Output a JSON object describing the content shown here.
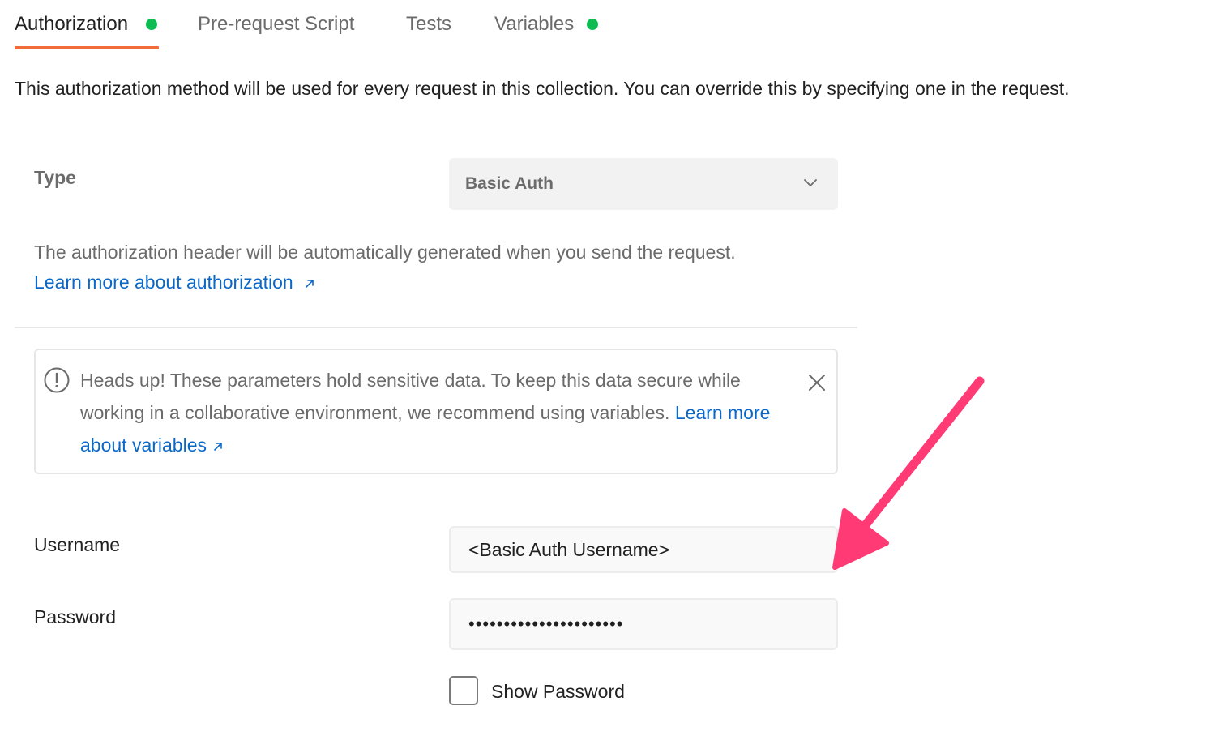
{
  "tabs": [
    {
      "label": "Authorization",
      "active": true,
      "has_indicator": true
    },
    {
      "label": "Pre-request Script",
      "active": false,
      "has_indicator": false
    },
    {
      "label": "Tests",
      "active": false,
      "has_indicator": false
    },
    {
      "label": "Variables",
      "active": false,
      "has_indicator": true
    }
  ],
  "intro_text": "This authorization method will be used for every request in this collection. You can override this by specifying one in the request.",
  "type": {
    "label": "Type",
    "selected": "Basic Auth"
  },
  "auth_description": "The authorization header will be automatically generated when you send the request.",
  "learn_auth_link": "Learn more about authorization",
  "alert": {
    "text": "Heads up! These parameters hold sensitive data. To keep this data secure while working in a collaborative environment, we recommend using variables.",
    "link": "Learn more about variables"
  },
  "username": {
    "label": "Username",
    "value": "<Basic Auth Username>"
  },
  "password": {
    "label": "Password",
    "value": "••••••••••••••••••••••"
  },
  "show_password": {
    "label": "Show Password",
    "checked": false
  },
  "colors": {
    "accent_tab": "#f26b3a",
    "indicator": "#0cbb52",
    "link": "#0b68c7",
    "annotation_arrow": "#ff3a75"
  },
  "icons": [
    "chevron-down-icon",
    "external-link-icon",
    "info-circle-icon",
    "close-icon",
    "annotation-arrow"
  ]
}
